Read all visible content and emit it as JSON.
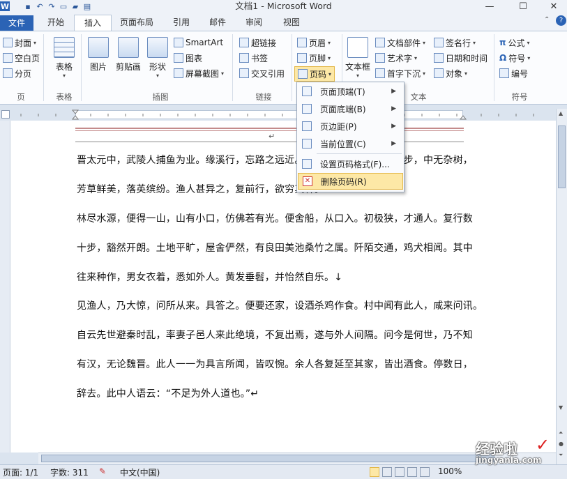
{
  "window": {
    "title": "文档1 - Microsoft Word",
    "minimize": "—",
    "maximize": "☐",
    "close": "✕"
  },
  "qat": {
    "app_icon": "W",
    "undo": "↶",
    "redo": "↷"
  },
  "tabs": [
    {
      "label": "文件"
    },
    {
      "label": "开始"
    },
    {
      "label": "插入"
    },
    {
      "label": "页面布局"
    },
    {
      "label": "引用"
    },
    {
      "label": "邮件"
    },
    {
      "label": "审阅"
    },
    {
      "label": "视图"
    }
  ],
  "ribbon": {
    "pages_group": {
      "label": "页",
      "items": [
        "封面",
        "空白页",
        "分页"
      ]
    },
    "table_group": {
      "label": "表格",
      "button": "表格"
    },
    "illus_group": {
      "label": "插图",
      "buttons": [
        "图片",
        "剪贴画",
        "形状"
      ],
      "small": [
        "SmartArt",
        "图表",
        "屏幕截图"
      ]
    },
    "links_group": {
      "label": "链接",
      "items": [
        "超链接",
        "书签",
        "交叉引用"
      ]
    },
    "hf_group": {
      "items": [
        "页眉",
        "页脚",
        "页码"
      ]
    },
    "text_group": {
      "label": "文本",
      "big": "文本框",
      "items": [
        "文档部件",
        "艺术字",
        "首字下沉"
      ],
      "items2": [
        "签名行",
        "日期和时间",
        "对象"
      ]
    },
    "symbol_group": {
      "label": "符号",
      "items": [
        "公式",
        "符号",
        "编号"
      ]
    }
  },
  "page_number_menu": {
    "items": [
      {
        "label": "页面顶端(T)",
        "submenu": true
      },
      {
        "label": "页面底端(B)",
        "submenu": true
      },
      {
        "label": "页边距(P)",
        "submenu": true
      },
      {
        "label": "当前位置(C)",
        "submenu": true
      },
      {
        "label": "设置页码格式(F)...",
        "submenu": false
      },
      {
        "label": "删除页码(R)",
        "submenu": false,
        "highlighted": true
      }
    ]
  },
  "document": {
    "header_mark": "↵",
    "lines": [
      "晋太元中，武陵人捕鱼为业。缘溪行，忘路之远近。忽逢桃花林，夹岸数百步，中无杂树，",
      "芳草鲜美，落英缤纷。渔人甚异之，复前行，欲穷其林。",
      "林尽水源，便得一山，山有小口，仿佛若有光。便舍船，从口入。初极狭，才通人。复行数",
      "十步，豁然开朗。土地平旷，屋舍俨然，有良田美池桑竹之属。阡陌交通，鸡犬相闻。其中",
      "往来种作，男女衣着，悉如外人。黄发垂髫，并怡然自乐。↓",
      "见渔人，乃大惊，问所从来。具答之。便要还家，设酒杀鸡作食。村中闻有此人，咸来问讯。",
      "自云先世避秦时乱，率妻子邑人来此绝境，不复出焉，遂与外人间隔。问今是何世，乃不知",
      "有汉，无论魏晋。此人一一为具言所闻，皆叹惋。余人各复延至其家，皆出酒食。停数日，",
      "辞去。此中人语云：“不足为外人道也。”↵"
    ]
  },
  "status": {
    "page": "页面: 1/1",
    "words": "字数: 311",
    "language": "中文(中国)",
    "zoom": "100%"
  },
  "watermark": {
    "text": "经验啦",
    "check": "✓",
    "url": "jingyanla.com"
  },
  "colors": {
    "accent": "#2b63b5",
    "highlight": "#fde8a6"
  }
}
